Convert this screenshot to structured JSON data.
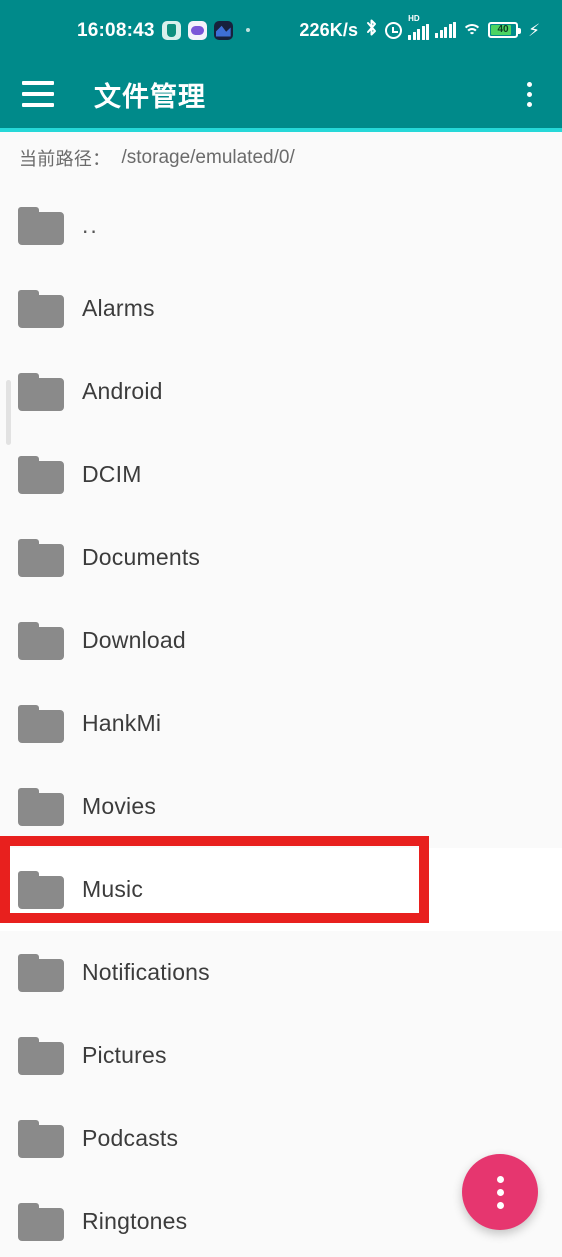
{
  "statusbar": {
    "time": "16:08:43",
    "app_icons": [
      "shield-icon",
      "game-icon",
      "map-icon"
    ],
    "notification_dot": "·",
    "network_speed": "226K/s",
    "bluetooth": "bluetooth-icon",
    "alarm": "alarm-icon",
    "signal_hd_label": "HD",
    "signal_bars_1": 5,
    "signal_bars_2": 5,
    "wifi": "wifi-icon",
    "battery_level": "40",
    "battery_color": "#4CD462",
    "charging": "⚡"
  },
  "appbar": {
    "menu_icon": "hamburger-menu-icon",
    "title": "文件管理",
    "overflow_icon": "overflow-menu-icon",
    "background_color": "#008A8A",
    "underline_color": "#26D8D8"
  },
  "pathbar": {
    "label": "当前路径：",
    "value": "/storage/emulated/0/"
  },
  "filelist": {
    "items": [
      {
        "name": "..",
        "icon": "folder-icon",
        "highlighted": false
      },
      {
        "name": "Alarms",
        "icon": "folder-icon",
        "highlighted": false
      },
      {
        "name": "Android",
        "icon": "folder-icon",
        "highlighted": false
      },
      {
        "name": "DCIM",
        "icon": "folder-icon",
        "highlighted": false
      },
      {
        "name": "Documents",
        "icon": "folder-icon",
        "highlighted": false
      },
      {
        "name": "Download",
        "icon": "folder-icon",
        "highlighted": false
      },
      {
        "name": "HankMi",
        "icon": "folder-icon",
        "highlighted": false
      },
      {
        "name": "Movies",
        "icon": "folder-icon",
        "highlighted": false
      },
      {
        "name": "Music",
        "icon": "folder-icon",
        "highlighted": true
      },
      {
        "name": "Notifications",
        "icon": "folder-icon",
        "highlighted": false
      },
      {
        "name": "Pictures",
        "icon": "folder-icon",
        "highlighted": false
      },
      {
        "name": "Podcasts",
        "icon": "folder-icon",
        "highlighted": false
      },
      {
        "name": "Ringtones",
        "icon": "folder-icon",
        "highlighted": false
      }
    ],
    "highlight_color": "#E8201E",
    "folder_color": "#8A8A8A"
  },
  "fab": {
    "icon": "overflow-menu-icon",
    "color": "#E6366F"
  }
}
